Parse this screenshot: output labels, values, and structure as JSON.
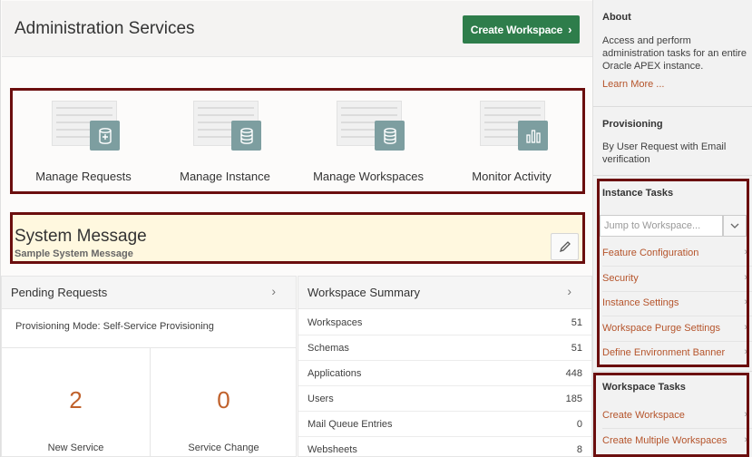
{
  "header": {
    "title": "Administration Services",
    "create_workspace_label": "Create Workspace",
    "create_workspace_chevron": "›"
  },
  "cards": [
    {
      "label": "Manage Requests",
      "icon": "add-database-icon"
    },
    {
      "label": "Manage Instance",
      "icon": "database-icon"
    },
    {
      "label": "Manage Workspaces",
      "icon": "database-icon"
    },
    {
      "label": "Monitor Activity",
      "icon": "bar-chart-icon"
    }
  ],
  "system_message": {
    "title": "System Message",
    "subtitle": "Sample System Message",
    "edit_icon": "pencil-icon"
  },
  "pending_requests": {
    "title": "Pending Requests",
    "chevron": "›",
    "mode": "Provisioning Mode: Self-Service Provisioning",
    "stats": [
      {
        "value": "2",
        "label": "New Service"
      },
      {
        "value": "0",
        "label": "Service Change"
      }
    ]
  },
  "workspace_summary": {
    "title": "Workspace Summary",
    "chevron": "›",
    "rows": [
      {
        "label": "Workspaces",
        "value": "51"
      },
      {
        "label": "Schemas",
        "value": "51"
      },
      {
        "label": "Applications",
        "value": "448"
      },
      {
        "label": "Users",
        "value": "185"
      },
      {
        "label": "Mail Queue Entries",
        "value": "0"
      },
      {
        "label": "Websheets",
        "value": "8"
      }
    ]
  },
  "sidebar": {
    "about_title": "About",
    "about_text": "Access and perform administration tasks for an entire Oracle APEX instance.",
    "learn_more": "Learn More ...",
    "provisioning_title": "Provisioning",
    "provisioning_text": "By User Request with Email verification",
    "instance_tasks_title": "Instance Tasks",
    "jump_placeholder": "Jump to Workspace...",
    "instance_tasks": [
      "Feature Configuration",
      "Security",
      "Instance Settings",
      "Workspace Purge Settings",
      "Define Environment Banner"
    ],
    "workspace_tasks_title": "Workspace Tasks",
    "workspace_tasks": [
      "Create Workspace",
      "Create Multiple Workspaces"
    ],
    "task_chevron": "›"
  },
  "colors": {
    "accent_green": "#2e7d4b",
    "link_orange": "#b5542b",
    "highlight_border": "#6b0e0e",
    "message_bg": "#fff8df",
    "badge": "#7d9ea0"
  }
}
